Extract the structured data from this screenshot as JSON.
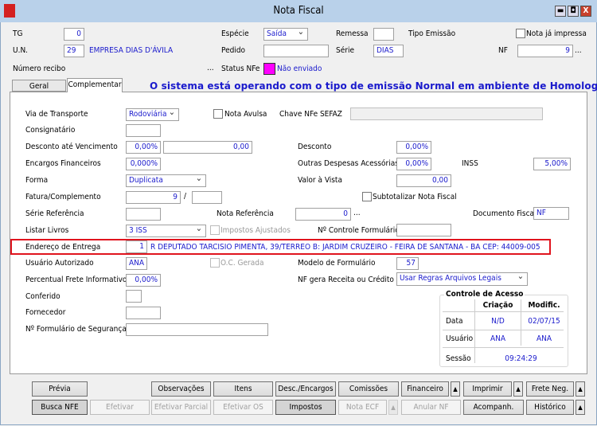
{
  "window": {
    "title": "Nota Fiscal",
    "minimize": "▬",
    "maximize": "◘",
    "close": "X"
  },
  "header": {
    "tg_label": "TG",
    "tg_value": "0",
    "especie_label": "Espécie",
    "especie_value": "Saída",
    "remessa_label": "Remessa",
    "remessa_value": "",
    "tipo_emissao_label": "Tipo Emissão",
    "nota_impressa_label": "Nota já impressa",
    "un_label": "U.N.",
    "un_value": "29",
    "un_name": "EMPRESA DIAS D'ÁVILA",
    "pedido_label": "Pedido",
    "pedido_value": "",
    "serie_label": "Série",
    "serie_value": "DIAS",
    "nf_label": "NF",
    "nf_value": "9",
    "ellipsis": "...",
    "numero_recibo_label": "Número recibo",
    "status_label": "Status NFe",
    "status_value": "Não enviado",
    "status_color": "#ff00ff"
  },
  "tabs": [
    {
      "label": "Geral"
    },
    {
      "label": "Complementar"
    }
  ],
  "banner": "O sistema está operando com o tipo de emissão Normal em ambiente de Homologação",
  "form": {
    "via_transporte_label": "Via de Transporte",
    "via_transporte_value": "Rodoviária",
    "nota_avulsa_label": "Nota Avulsa",
    "chave_label": "Chave NFe SEFAZ",
    "chave_value": "",
    "consignatario_label": "Consignatário",
    "desc_venc_label": "Desconto até Vencimento",
    "desc_venc_pct": "0,00%",
    "desc_venc_value": "0,00",
    "desconto_label": "Desconto",
    "desconto_value": "0,00%",
    "encargos_label": "Encargos Financeiros",
    "encargos_value": "0,000%",
    "outras_label": "Outras Despesas Acessórias",
    "outras_value": "0,00%",
    "inss_label": "INSS",
    "inss_value": "5,00%",
    "forma_label": "Forma",
    "forma_value": "Duplicata",
    "valor_vista_label": "Valor à Vista",
    "valor_vista_value": "0,00",
    "fatura_label": "Fatura/Complemento",
    "fatura_value": "9",
    "fatura_sep": "/",
    "fatura_comp": "",
    "subtotalizar_label": "Subtotalizar Nota Fiscal",
    "serie_ref_label": "Série Referência",
    "nota_ref_label": "Nota Referência",
    "nota_ref_value": "0",
    "doc_fiscal_label": "Documento Fiscal",
    "doc_fiscal_value": "NF",
    "listar_livros_label": "Listar Livros",
    "listar_livros_value": "3 ISS",
    "impostos_ajustados_label": "Impostos Ajustados",
    "controle_form_label": "Nº Controle Formulário",
    "endereco_label": "Endereço de Entrega",
    "endereco_num": "1",
    "endereco_text": "R DEPUTADO TARCISIO PIMENTA, 39/TERREO B: JARDIM CRUZEIRO - FEIRA DE SANTANA - BA CEP: 44009-005",
    "usuario_aut_label": "Usuário Autorizado",
    "usuario_aut_value": "ANA",
    "oc_gerada_label": "O.C. Gerada",
    "modelo_label": "Modelo de Formulário",
    "modelo_value": "57",
    "perc_frete_label": "Percentual Frete Informativo",
    "perc_frete_value": "0,00%",
    "nf_gera_label": "NF gera Receita ou Crédito",
    "nf_gera_value": "Usar Regras Arquivos Legais",
    "conferido_label": "Conferido",
    "fornecedor_label": "Fornecedor",
    "form_seg_label": "Nº Formulário de Segurança"
  },
  "acesso": {
    "title": "Controle de Acesso",
    "col_criacao": "Criação",
    "col_modif": "Modific.",
    "data_label": "Data",
    "data_criacao": "N/D",
    "data_modif": "02/07/15",
    "usuario_label": "Usuário",
    "usuario_criacao": "ANA",
    "usuario_modif": "ANA",
    "sessao_label": "Sessão",
    "sessao_value": "09:24:29"
  },
  "buttons": {
    "previa": "Prévia",
    "observacoes": "Observações",
    "itens": "Itens",
    "desc_encargos": "Desc./Encargos",
    "comissoes": "Comissões",
    "financeiro": "Financeiro",
    "imprimir": "Imprimir",
    "frete_neg": "Frete Neg.",
    "busca_nfe": "Busca NFE",
    "efetivar": "Efetivar",
    "efetivar_parcial": "Efetivar Parcial",
    "efetivar_os": "Efetivar OS",
    "impostos": "Impostos",
    "nota_ecf": "Nota ECF",
    "anular_nf": "Anular NF",
    "acompanh": "Acompanh.",
    "historico": "Histórico",
    "arrow": "▲"
  }
}
